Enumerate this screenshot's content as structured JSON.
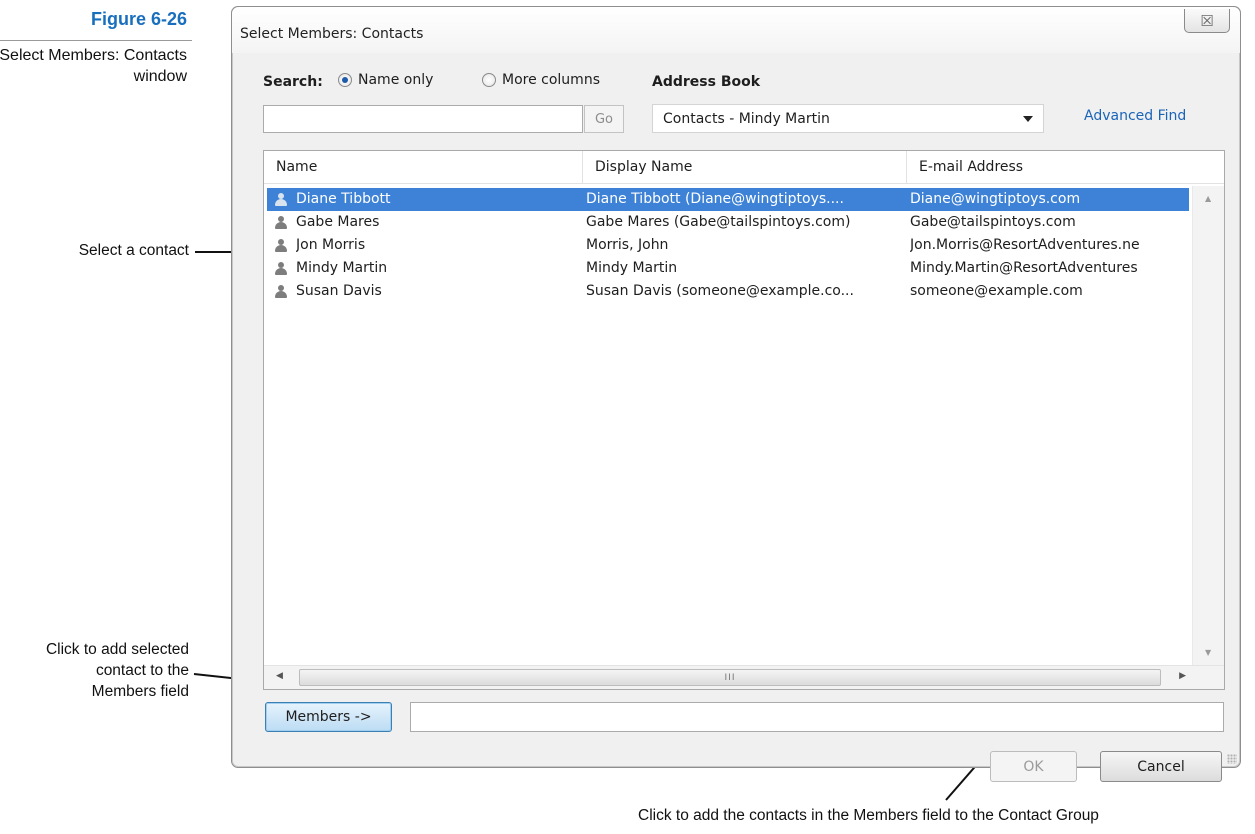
{
  "figure": {
    "label": "Figure 6-26",
    "caption": "Select Members: Contacts window"
  },
  "callouts": {
    "select_contact": "Select a contact",
    "add_selected_line1": "Click to add selected",
    "add_selected_line2": "contact to the",
    "add_selected_line3": "Members field",
    "ok_note": "Click to add the contacts in the Members field to the Contact Group"
  },
  "dialog": {
    "title": "Select Members: Contacts",
    "close_glyph": "☒"
  },
  "search": {
    "label": "Search:",
    "option_name_only": "Name only",
    "option_more_columns": "More columns",
    "selected_option": "Name only",
    "value": "",
    "go_label": "Go"
  },
  "address_book": {
    "label": "Address Book",
    "selected": "Contacts - Mindy Martin",
    "advanced_find": "Advanced Find"
  },
  "list": {
    "columns": [
      "Name",
      "Display Name",
      "E-mail Address"
    ],
    "rows": [
      {
        "name": "Diane Tibbott",
        "display": "Diane Tibbott (Diane@wingtiptoys....",
        "email": "Diane@wingtiptoys.com",
        "selected": true
      },
      {
        "name": "Gabe Mares",
        "display": "Gabe Mares (Gabe@tailspintoys.com)",
        "email": "Gabe@tailspintoys.com",
        "selected": false
      },
      {
        "name": "Jon Morris",
        "display": "Morris, John",
        "email": "Jon.Morris@ResortAdventures.ne",
        "selected": false
      },
      {
        "name": "Mindy Martin",
        "display": "Mindy Martin",
        "email": "Mindy.Martin@ResortAdventures",
        "selected": false
      },
      {
        "name": "Susan Davis",
        "display": "Susan Davis (someone@example.co...",
        "email": "someone@example.com",
        "selected": false
      }
    ],
    "row_icon": "contact-person-icon",
    "hscroll_grip": "III"
  },
  "footer": {
    "members_label": "Members ->",
    "members_value": "",
    "ok_label": "OK",
    "cancel_label": "Cancel"
  },
  "colors": {
    "figure_label": "#1a6fbd",
    "selection": "#3d82d6",
    "link": "#1a64b8"
  }
}
